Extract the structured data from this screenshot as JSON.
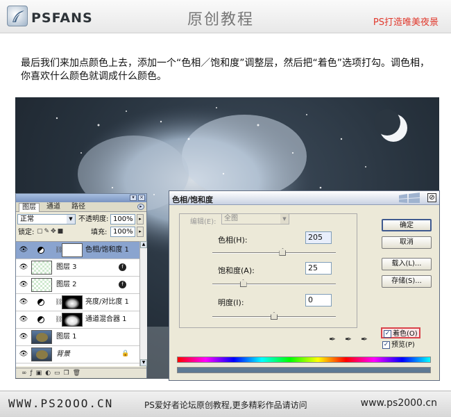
{
  "header": {
    "logo_text": "PSFANS",
    "title": "原创教程",
    "slogan": "PS打造唯美夜景"
  },
  "intro": {
    "text": "最后我们来加点颜色上去，添加一个“色相／饱和度”调整层，然后把“着色”选项打勾。调色相，你喜欢什么颜色就调成什么颜色。"
  },
  "layers_panel": {
    "tabs": [
      "图层",
      "通道",
      "路径"
    ],
    "blend_mode": "正常",
    "opacity_label": "不透明度:",
    "opacity_value": "100%",
    "lock_label": "锁定:",
    "fill_label": "填充:",
    "fill_value": "100%",
    "layers": [
      {
        "name": "色相/饱和度 1",
        "selected": true
      },
      {
        "name": "图层 3"
      },
      {
        "name": "图层 2"
      },
      {
        "name": "亮度/对比度 1"
      },
      {
        "name": "通道混合器 1"
      },
      {
        "name": "图层 1"
      },
      {
        "name": "背景"
      }
    ]
  },
  "dialog": {
    "title": "色相/饱和度",
    "edit_label": "编辑(E):",
    "edit_value": "全图",
    "hue_label": "色相(H):",
    "hue_value": "205",
    "hue_fraction": 0.57,
    "saturation_label": "饱和度(A):",
    "saturation_value": "25",
    "saturation_fraction": 0.25,
    "lightness_label": "明度(I):",
    "lightness_value": "0",
    "lightness_fraction": 0.5,
    "ok_label": "确定",
    "cancel_label": "取消",
    "load_label": "载入(L)...",
    "save_label": "存储(S)...",
    "colorize_label": "着色(O)",
    "preview_label": "预览(P)",
    "colorize_checked": true,
    "preview_checked": true
  },
  "footer": {
    "left": "WWW.PS2OOO.CN",
    "center": "PS爱好者论坛原创教程,更多精彩作品请访问",
    "right": "www.ps2000.cn"
  },
  "colors": {
    "slogan": "#e0382c",
    "selected_layer": "#8aa4cf",
    "colorize_highlight": "#d9424a",
    "result_bar": "#5e7a94"
  }
}
